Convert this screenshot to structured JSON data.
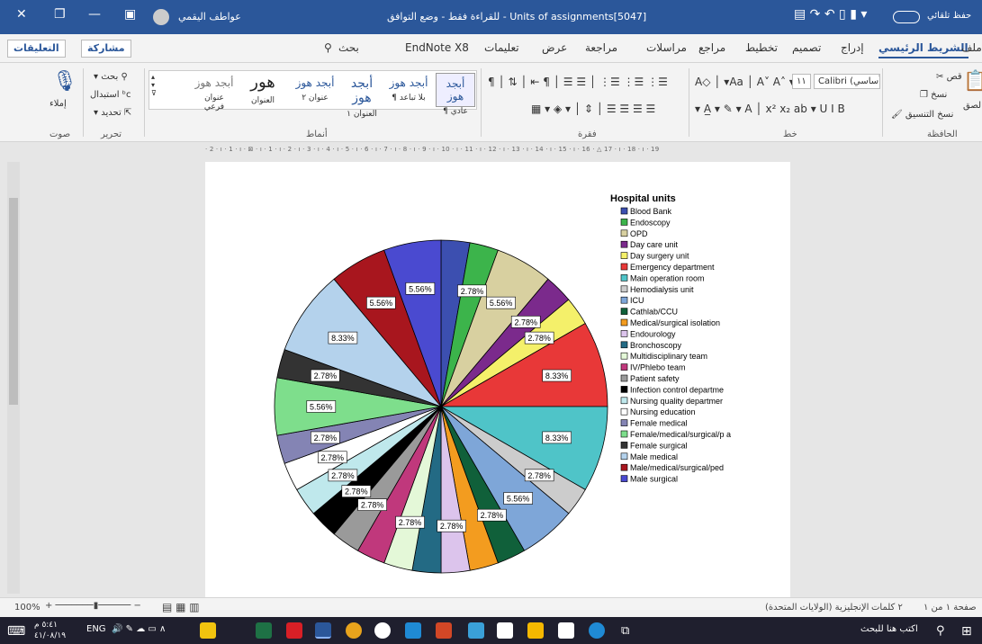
{
  "titlebar": {
    "title": "Units of assignments[5047] - للقراءة فقط - وضع التوافق",
    "user": "عواطف اليقمي",
    "autosave": "حفظ تلقائي"
  },
  "tabs": {
    "file": "ملف",
    "home": "الشريط الرئيسي",
    "insert": "إدراج",
    "design": "تصميم",
    "layout": "تخطيط",
    "references": "مراجع",
    "mailings": "مراسلات",
    "review": "مراجعة",
    "view": "عرض",
    "help": "تعليمات",
    "endnote": "EndNote X8",
    "search": "بحث",
    "share": "مشاركة",
    "comments": "التعليقات"
  },
  "ribbon": {
    "clipboard": "الحافظة",
    "paste": "لصق",
    "cut": "قص",
    "copy": "نسخ",
    "format_painter": "نسخ التنسيق",
    "font_group": "خط",
    "font_name": "Calibri (أساسي)",
    "font_size": "١١",
    "paragraph": "فقرة",
    "styles_group": "أنماط",
    "editing": "تحرير",
    "find": "بحث",
    "replace": "استبدال",
    "select": "تحديد",
    "voice": "صوت",
    "dictate": "إملاء",
    "styles": [
      {
        "sample": "أبجد هوز",
        "name": "¶ عادي"
      },
      {
        "sample": "أبجد هوز",
        "name": "¶ بلا تباعد"
      },
      {
        "sample": "أبجد هوز",
        "name": "العنوان ١"
      },
      {
        "sample": "أبجد هوز",
        "name": "عنوان ٢"
      },
      {
        "sample": "هور",
        "name": "العنوان"
      },
      {
        "sample": "أبجد هوز",
        "name": "عنوان فرعي"
      }
    ]
  },
  "ruler": "· 2 · ı · 1 · ı · ⊠ · ı · 1 · ı · 2 · ı · 3 · ı · 4 · ı · 5 · ı · 6 · ı · 7 · ı · 8 · ı · 9 · ı · 10 · ı · 11 · ı · 12 · ı · 13 · ı · 14 · ı · 15 · ı · 16 · △ 17 · ı · 18 · ı · 19",
  "chart_data": {
    "type": "pie",
    "legend_title": "Hospital units",
    "legend_position": "right",
    "slices": [
      {
        "label": "Blood Bank",
        "value": 2.78,
        "color": "#3c4fb0",
        "shown": ""
      },
      {
        "label": "Endoscopy",
        "value": 2.78,
        "color": "#3cb44b",
        "shown": "2.78%"
      },
      {
        "label": "OPD",
        "value": 5.56,
        "color": "#d8d0a0",
        "shown": "5.56%"
      },
      {
        "label": "Day care unit",
        "value": 2.78,
        "color": "#7b2a8c",
        "shown": "2.78%"
      },
      {
        "label": "Day surgery unit",
        "value": 2.78,
        "color": "#f4f06a",
        "shown": "2.78%"
      },
      {
        "label": "Emergency department",
        "value": 8.33,
        "color": "#e83838",
        "shown": "8.33%"
      },
      {
        "label": "Main operation room",
        "value": 8.33,
        "color": "#4fc4c8",
        "shown": "8.33%"
      },
      {
        "label": "Hemodialysis unit",
        "value": 2.78,
        "color": "#cccccc",
        "shown": "2.78%"
      },
      {
        "label": "ICU",
        "value": 5.56,
        "color": "#7ea6d8",
        "shown": "5.56%"
      },
      {
        "label": "Cathlab/CCU",
        "value": 2.78,
        "color": "#10603a",
        "shown": "2.78%"
      },
      {
        "label": "Medical/surgical isolation",
        "value": 2.78,
        "color": "#f39c1f",
        "shown": ""
      },
      {
        "label": "Endourology",
        "value": 2.78,
        "color": "#dcc4ec",
        "shown": "2.78%"
      },
      {
        "label": "Bronchoscopy",
        "value": 2.78,
        "color": "#236a84",
        "shown": ""
      },
      {
        "label": "Multidisciplinary team",
        "value": 2.78,
        "color": "#e4f8d8",
        "shown": "2.78%"
      },
      {
        "label": "IV/Phlebo team",
        "value": 2.78,
        "color": "#c0387c",
        "shown": ""
      },
      {
        "label": "Patient safety",
        "value": 2.78,
        "color": "#9a9a9a",
        "shown": "2.78%"
      },
      {
        "label": "Infection control departme",
        "value": 2.78,
        "color": "#000000",
        "shown": "2.78%"
      },
      {
        "label": "Nursing quality departmer",
        "value": 2.78,
        "color": "#bfe8ec",
        "shown": "2.78%"
      },
      {
        "label": "Nursing education",
        "value": 2.78,
        "color": "#ffffff",
        "shown": "2.78%"
      },
      {
        "label": "Female medical",
        "value": 2.78,
        "color": "#8484b4",
        "shown": "2.78%"
      },
      {
        "label": "Female/medical/surgical/p a",
        "value": 5.56,
        "color": "#7ede8c",
        "shown": "5.56%"
      },
      {
        "label": "Female surgical",
        "value": 2.78,
        "color": "#333333",
        "shown": "2.78%"
      },
      {
        "label": "Male medical",
        "value": 8.33,
        "color": "#b4d2ec",
        "shown": "8.33%"
      },
      {
        "label": "Male/medical/surgical/ped",
        "value": 5.56,
        "color": "#a8161e",
        "shown": "5.56%"
      },
      {
        "label": "Male surgical",
        "value": 5.56,
        "color": "#4a4ad0",
        "shown": "5.56%"
      }
    ]
  },
  "status": {
    "page": "صفحة ١ من ١",
    "words": "٢ كلمات",
    "language": "الإنجليزية (الولايات المتحدة)",
    "zoom": "100%"
  },
  "taskbar": {
    "search": "اكتب هنا للبحث",
    "lang": "ENG",
    "time": "٥:٤١ م",
    "date": "٤١/٠٨/١٩"
  }
}
